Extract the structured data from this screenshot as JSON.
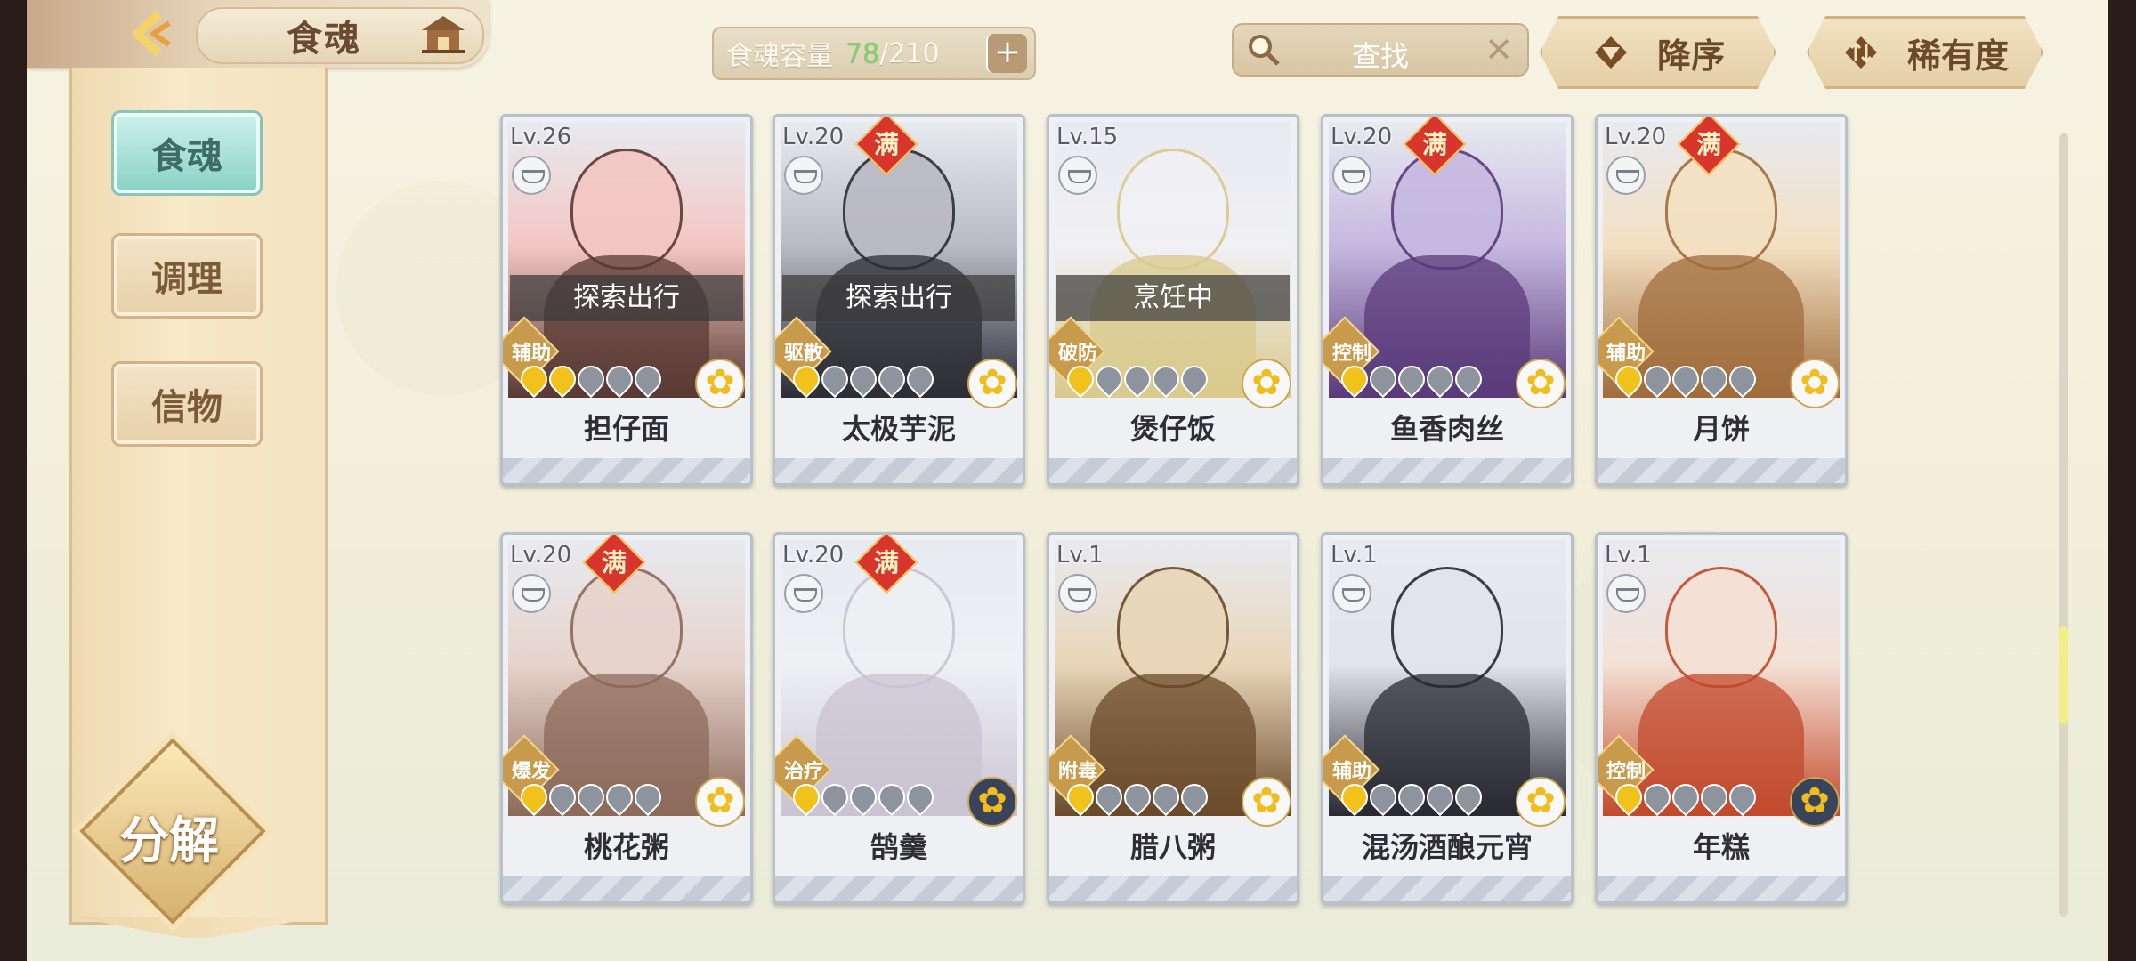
{
  "header": {
    "title": "食魂",
    "capacity": {
      "label": "食魂容量",
      "current": "78",
      "separator": "/",
      "max": "210",
      "add": "+"
    },
    "search": {
      "label": "查找",
      "clear": "✕"
    },
    "sort_order": "降序",
    "sort_by": "稀有度"
  },
  "sidebar": {
    "items": [
      {
        "label": "食魂",
        "active": true
      },
      {
        "label": "调理",
        "active": false
      },
      {
        "label": "信物",
        "active": false
      }
    ],
    "decompose": "分解"
  },
  "cards": [
    {
      "level": "Lv.26",
      "name": "担仔面",
      "role": "辅助",
      "status": "探索出行",
      "full": false,
      "flames": 2,
      "full_label": ""
    },
    {
      "level": "Lv.20",
      "name": "太极芋泥",
      "role": "驱散",
      "status": "探索出行",
      "full": true,
      "flames": 1,
      "full_label": "满"
    },
    {
      "level": "Lv.15",
      "name": "煲仔饭",
      "role": "破防",
      "status": "烹饪中",
      "full": false,
      "flames": 1,
      "full_label": ""
    },
    {
      "level": "Lv.20",
      "name": "鱼香肉丝",
      "role": "控制",
      "status": "",
      "full": true,
      "flames": 1,
      "full_label": "满"
    },
    {
      "level": "Lv.20",
      "name": "月饼",
      "role": "辅助",
      "status": "",
      "full": true,
      "flames": 1,
      "full_label": "满"
    },
    {
      "level": "Lv.20",
      "name": "桃花粥",
      "role": "爆发",
      "status": "",
      "full": true,
      "flames": 1,
      "full_label": "满"
    },
    {
      "level": "Lv.20",
      "name": "鹄羹",
      "role": "治疗",
      "status": "",
      "full": true,
      "flames": 1,
      "full_label": "满"
    },
    {
      "level": "Lv.1",
      "name": "腊八粥",
      "role": "附毒",
      "status": "",
      "full": false,
      "flames": 1,
      "full_label": ""
    },
    {
      "level": "Lv.1",
      "name": "混汤酒酿元宵",
      "role": "辅助",
      "status": "",
      "full": false,
      "flames": 1,
      "full_label": ""
    },
    {
      "level": "Lv.1",
      "name": "年糕",
      "role": "控制",
      "status": "",
      "full": false,
      "flames": 1,
      "full_label": ""
    }
  ],
  "scroll_position": 0.63,
  "colors": {
    "accent_teal": "#88d1c6",
    "capacity_green": "#7bd26b",
    "full_badge": "#d8352c"
  }
}
